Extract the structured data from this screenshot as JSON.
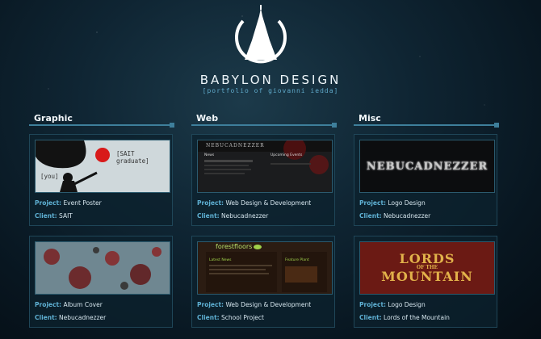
{
  "header": {
    "brand": "BABYLON DESIGN",
    "tagline": "[portfolio of giovanni iedda]"
  },
  "columns": [
    {
      "title": "Graphic",
      "cards": [
        {
          "project_label": "Project:",
          "project": "Event Poster",
          "client_label": "Client:",
          "client": "SAIT",
          "thumb_text": [
            "[SAIT graduate]",
            "[you]"
          ]
        },
        {
          "project_label": "Project:",
          "project": "Album Cover",
          "client_label": "Client:",
          "client": "Nebucadnezzer"
        }
      ]
    },
    {
      "title": "Web",
      "cards": [
        {
          "project_label": "Project:",
          "project": "Web Design & Development",
          "client_label": "Client:",
          "client": "Nebucadnezzer",
          "thumb_text": [
            "NEBUCADNEZZER",
            "News",
            "Upcoming Events"
          ]
        },
        {
          "project_label": "Project:",
          "project": "Web Design & Development",
          "client_label": "Client:",
          "client": "School Project",
          "thumb_text": [
            "forestfloors",
            "Latest News",
            "Feature Plant"
          ]
        }
      ]
    },
    {
      "title": "Misc",
      "cards": [
        {
          "project_label": "Project:",
          "project": "Logo Design",
          "client_label": "Client:",
          "client": "Nebucadnezzer",
          "thumb_text": [
            "NEBUCADNEZZER"
          ]
        },
        {
          "project_label": "Project:",
          "project": "Logo Design",
          "client_label": "Client:",
          "client": "Lords of the Mountain",
          "thumb_text": [
            "LORDS",
            "OF THE",
            "MOUNTAIN"
          ]
        }
      ]
    }
  ],
  "colors": {
    "accent": "#5fb1d4",
    "rule": "#3e7f9b",
    "bg": "#0f2533"
  }
}
